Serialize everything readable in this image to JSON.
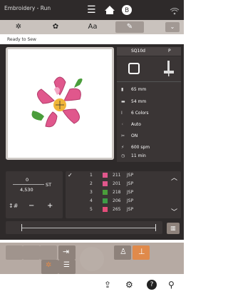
{
  "window": {
    "title": "Embroidery - Run"
  },
  "status": {
    "ready": "Ready to Sew"
  },
  "tabs": [
    {
      "icon": "needle-settings-icon"
    },
    {
      "icon": "embroidery-edit-icon"
    },
    {
      "label": "Aa"
    },
    {
      "icon": "stitch-edit-icon"
    }
  ],
  "design": {
    "header": "SQ10d",
    "header_right": "P",
    "width": "65 mm",
    "height": "54 mm",
    "colors": "6 Colors",
    "thread_trim": "Auto",
    "tie": "ON",
    "speed": "600 spm",
    "time": "11 min"
  },
  "stitch": {
    "current": "0",
    "unit": "ST",
    "total": "4,530"
  },
  "colors": [
    {
      "index": "1",
      "num": "211",
      "brand": "JSP",
      "color": "#e0578c"
    },
    {
      "index": "2",
      "num": "201",
      "brand": "JSP",
      "color": "#e0578c"
    },
    {
      "index": "3",
      "num": "218",
      "brand": "JSP",
      "color": "#4a9d3b"
    },
    {
      "index": "4",
      "num": "206",
      "brand": "JSP",
      "color": "#3d9c47"
    },
    {
      "index": "5",
      "num": "265",
      "brand": "JSP",
      "color": "#e44d7a"
    }
  ],
  "accent": "#e08a4b"
}
